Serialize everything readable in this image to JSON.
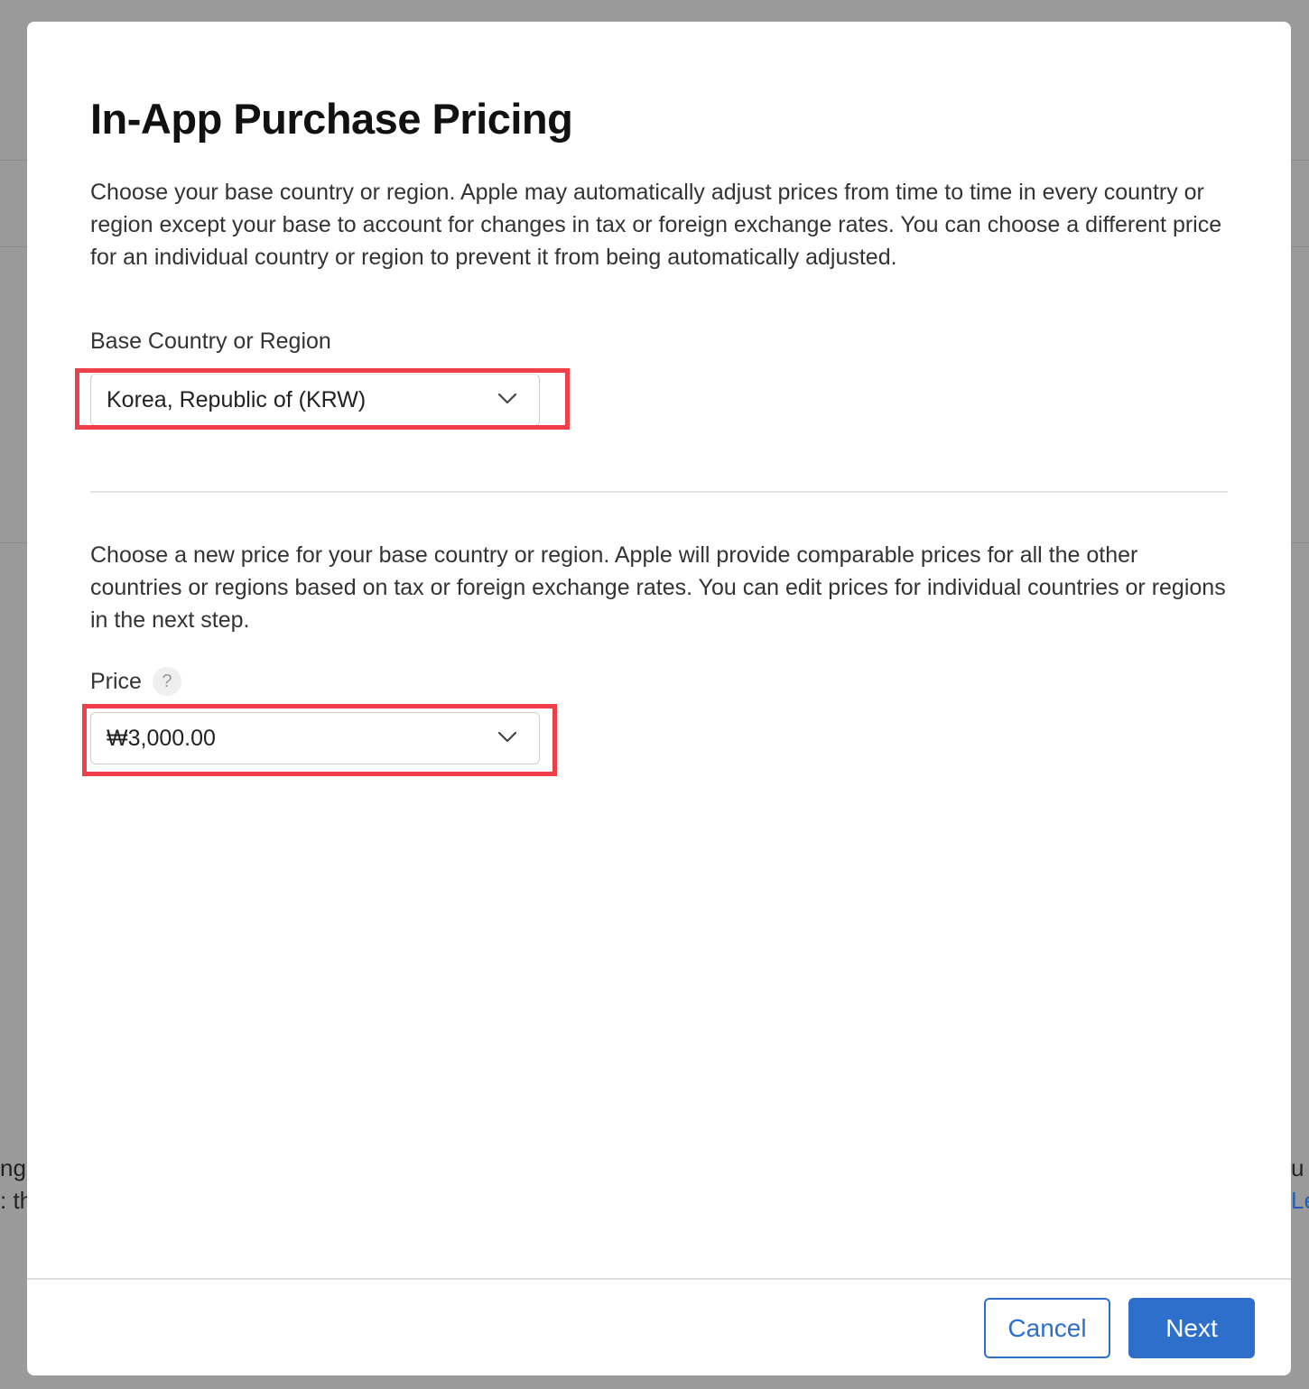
{
  "background": {
    "left_text": [
      "ng",
      ": th"
    ],
    "right_text": [
      "u",
      "Le"
    ]
  },
  "dialog": {
    "title": "In-App Purchase Pricing",
    "intro": "Choose your base country or region. Apple may automatically adjust prices from time to time in every country or region except your base to account for changes in tax or foreign exchange rates. You can choose a different price for an individual country or region to prevent it from being automatically adjusted.",
    "base_country": {
      "label": "Base Country or Region",
      "value": "Korea, Republic of (KRW)"
    },
    "price_intro": "Choose a new price for your base country or region. Apple will provide comparable prices for all the other countries or regions based on tax or foreign exchange rates. You can edit prices for individual countries or regions in the next step.",
    "price": {
      "label": "Price",
      "help_glyph": "?",
      "value": "₩3,000.00"
    },
    "buttons": {
      "cancel": "Cancel",
      "next": "Next"
    }
  },
  "colors": {
    "accent": "#2e6fcc",
    "highlight": "#ef3f48"
  }
}
